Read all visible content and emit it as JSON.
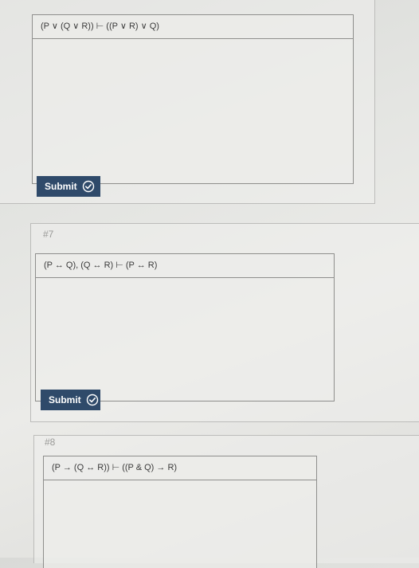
{
  "questions": [
    {
      "number": "",
      "formula": "(P ∨ (Q ∨ R)) ⊢ ((P ∨ R) ∨ Q)",
      "submit_label": "Submit"
    },
    {
      "number": "#7",
      "formula": "(P ↔ Q), (Q ↔ R) ⊢ (P ↔ R)",
      "submit_label": "Submit"
    },
    {
      "number": "#8",
      "formula": "(P → (Q ↔ R)) ⊢ ((P & Q) → R)",
      "submit_label": ""
    }
  ],
  "icons": {
    "submit_check": "check-circle-icon"
  },
  "colors": {
    "submit_bg": "#2f4a6a",
    "submit_text": "#ffffff"
  }
}
